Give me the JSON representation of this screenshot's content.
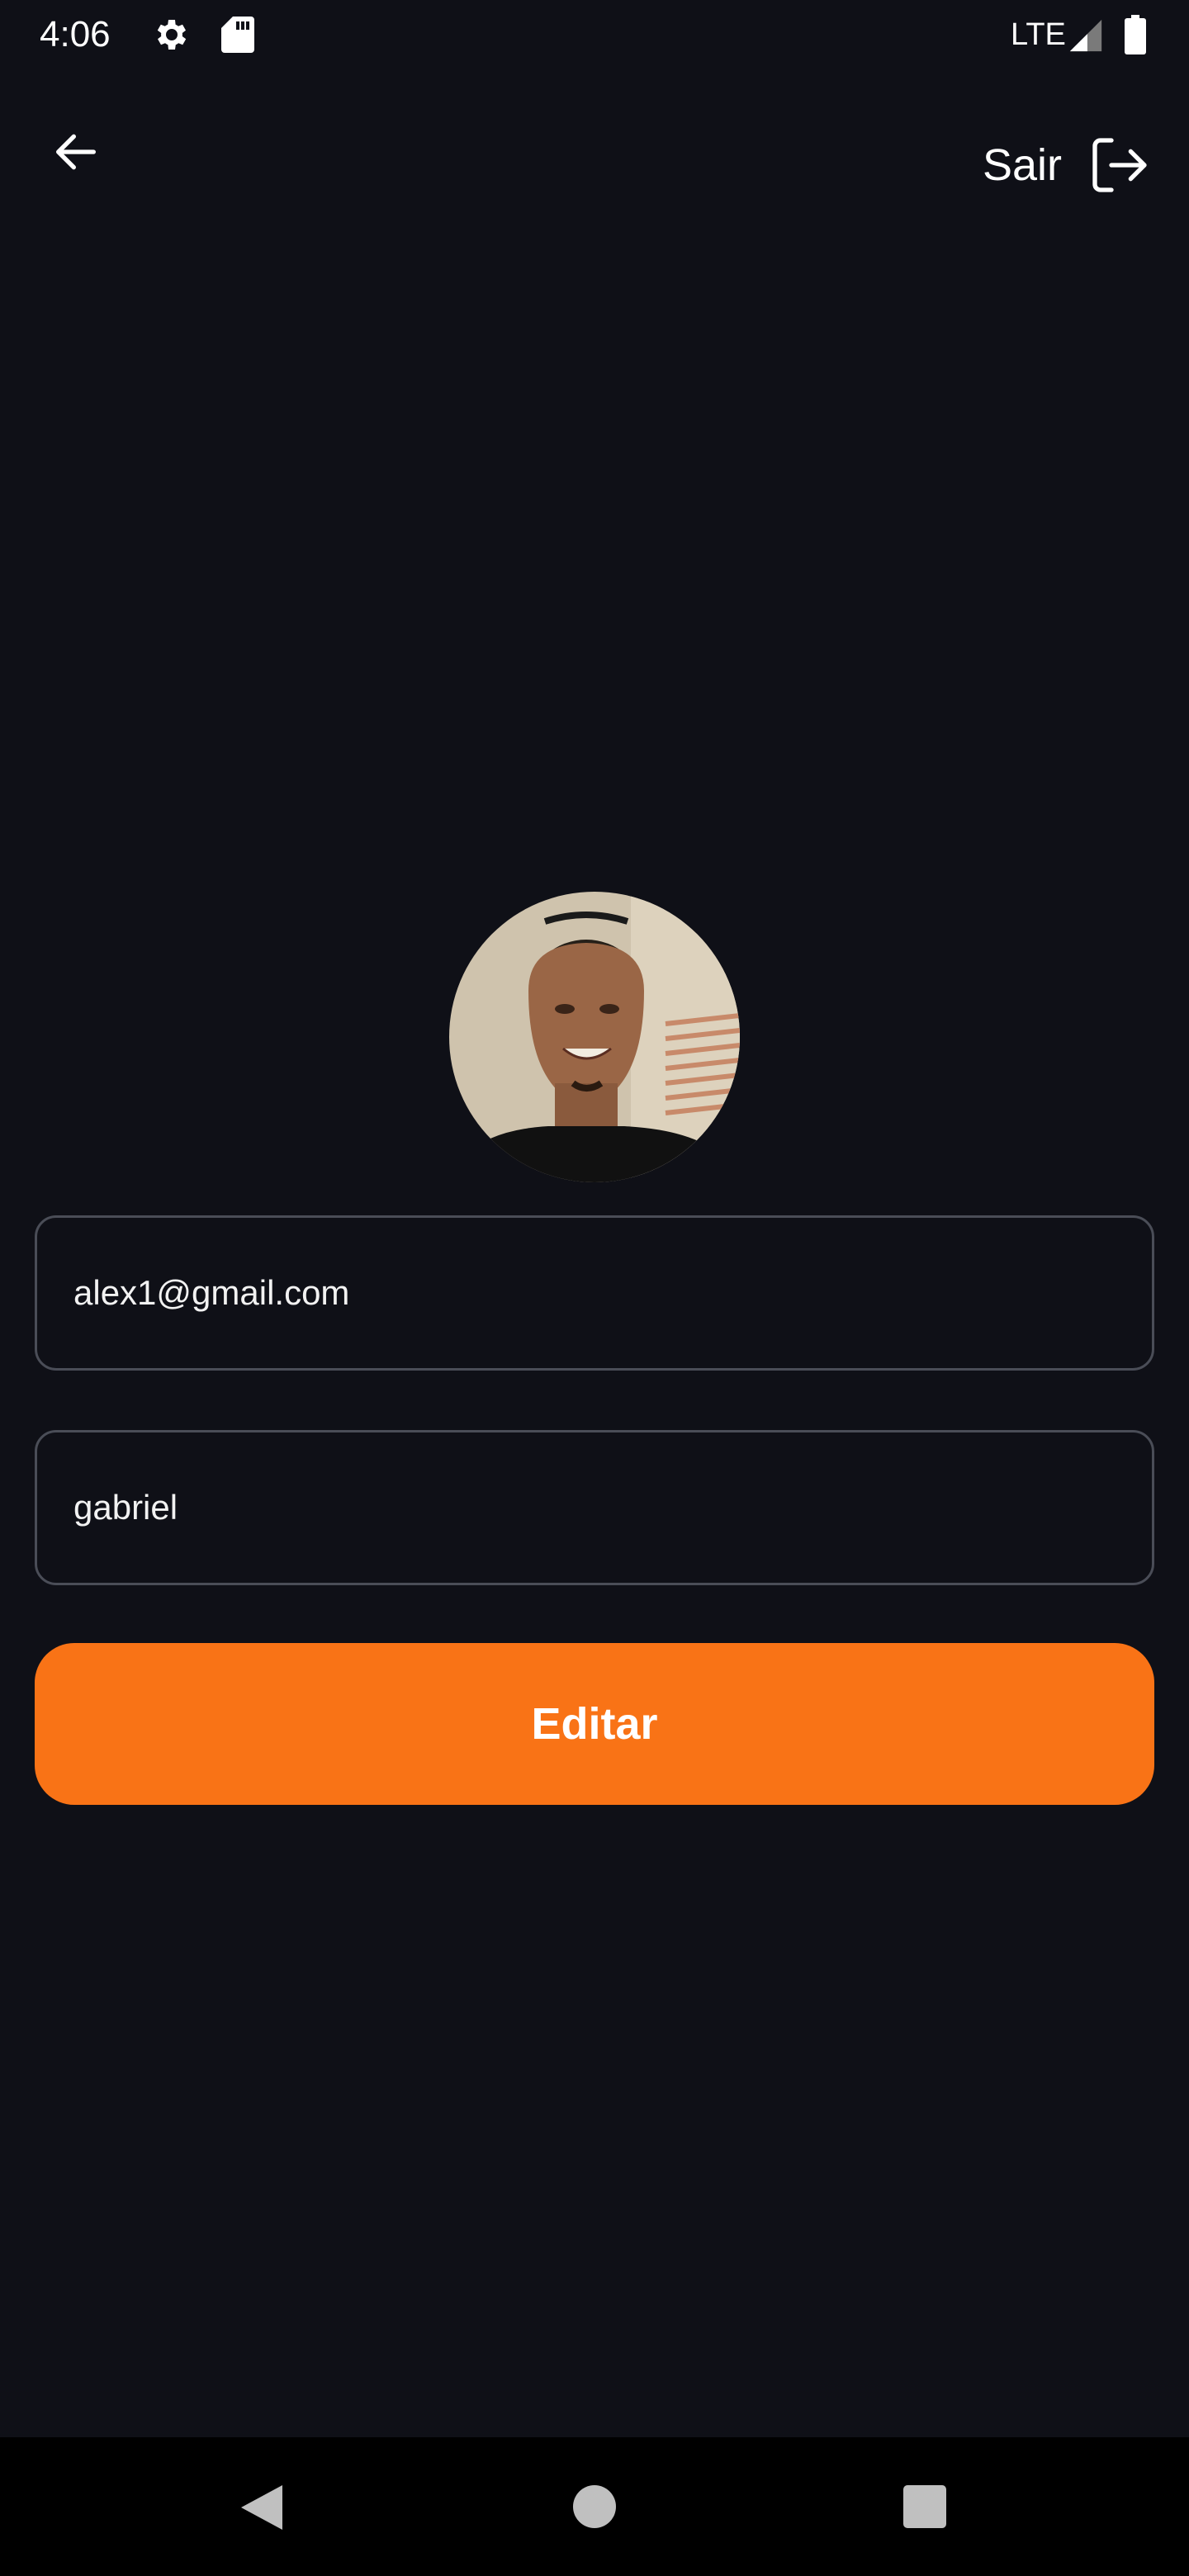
{
  "status_bar": {
    "time": "4:06",
    "network": "LTE",
    "icons": [
      "gear-icon",
      "sd-card-icon",
      "signal-icon",
      "battery-icon"
    ]
  },
  "top_bar": {
    "back_icon": "arrow-left-icon",
    "logout_label": "Sair",
    "logout_icon": "logout-icon"
  },
  "profile": {
    "email": "alex1@gmail.com",
    "name": "gabriel"
  },
  "actions": {
    "edit_label": "Editar"
  },
  "nav_bar": {
    "icons": [
      "nav-back-icon",
      "nav-home-icon",
      "nav-recents-icon"
    ]
  },
  "colors": {
    "background": "#0f1017",
    "accent": "#f97316",
    "input_border": "#4a4d57",
    "text": "#ffffff"
  }
}
